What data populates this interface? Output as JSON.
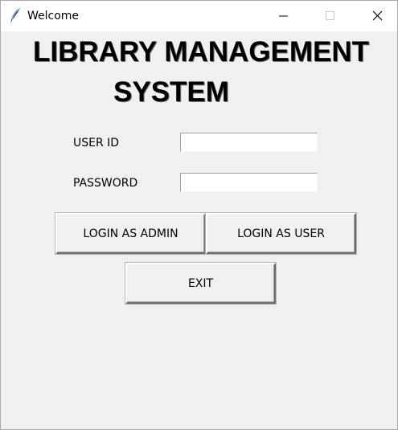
{
  "window": {
    "title": "Welcome",
    "icon": "feather-icon",
    "controls": [
      "minimize-icon",
      "maximize-icon",
      "close-icon"
    ]
  },
  "heading": {
    "line1": "LIBRARY MANAGEMENT",
    "line2": "SYSTEM"
  },
  "form": {
    "user_id_label": "USER ID",
    "user_id_value": "",
    "password_label": "PASSWORD",
    "password_value": ""
  },
  "buttons": {
    "login_admin": "LOGIN AS ADMIN",
    "login_user": "LOGIN AS USER",
    "exit": "EXIT"
  }
}
